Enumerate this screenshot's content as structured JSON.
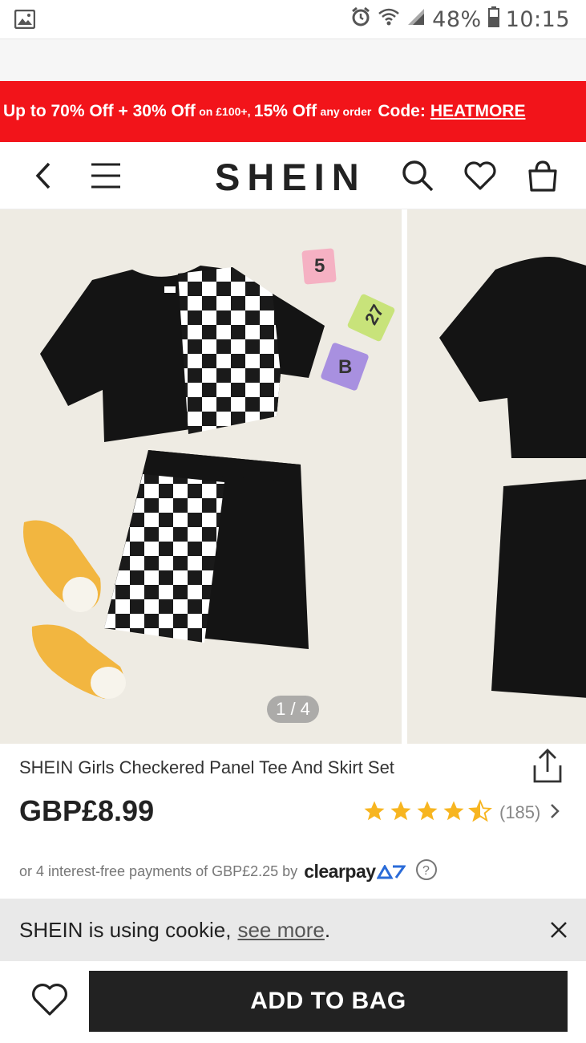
{
  "status_bar": {
    "battery": "48%",
    "time": "10:15"
  },
  "promo": {
    "part1": "Up to 70% Off + 30% Off",
    "part2": "on £100+,",
    "part3": "15% Off",
    "part4": "any order",
    "code_label": "Code:",
    "code": "HEATMORE"
  },
  "header": {
    "logo": "SHEIN"
  },
  "gallery": {
    "counter": "1 / 4"
  },
  "product": {
    "title": "SHEIN Girls Checkered Panel Tee And Skirt Set",
    "price": "GBP£8.99",
    "rating": 4.5,
    "review_count": "(185)",
    "installments_text": "or 4 interest-free payments of GBP£2.25 by",
    "clearpay_label": "clearpay"
  },
  "cookie": {
    "message": "SHEIN is using cookie,",
    "link": "see more",
    "period": "."
  },
  "bottom": {
    "add_to_bag": "ADD TO BAG"
  }
}
